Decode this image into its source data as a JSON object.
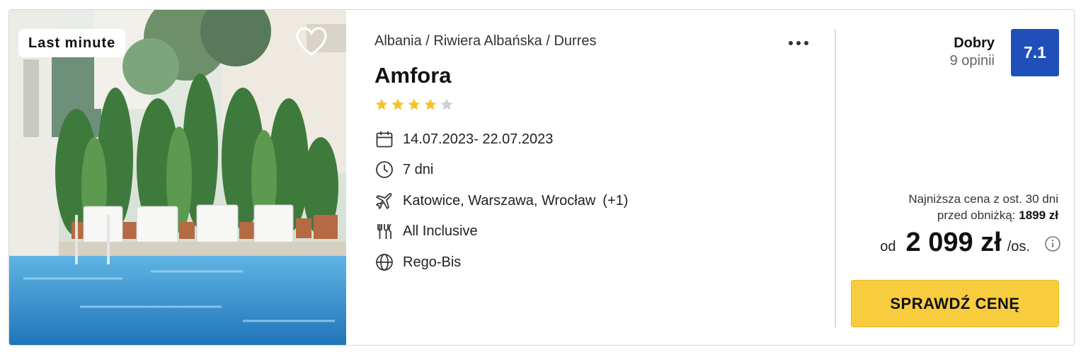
{
  "badge": "Last minute",
  "breadcrumb": "Albania / Riwiera Albańska / Durres",
  "hotel": {
    "name": "Amfora",
    "stars_filled": 4,
    "stars_total": 5,
    "star_color": "#f5c22b",
    "star_empty_color": "#cfcfcf"
  },
  "details": {
    "dates": "14.07.2023- 22.07.2023",
    "duration": "7 dni",
    "departures": "Katowice, Warszawa, Wrocław",
    "departures_extra": "(+1)",
    "board": "All Inclusive",
    "operator": "Rego-Bis"
  },
  "icons": {
    "calendar": "calendar-icon",
    "clock": "clock-icon",
    "plane": "plane-icon",
    "cutlery": "cutlery-icon",
    "globe": "globe-icon",
    "heart": "heart-icon",
    "more": "more-dots-icon",
    "info": "info-icon"
  },
  "rating": {
    "label": "Dobry",
    "count": "9 opinii",
    "score": "7.1",
    "score_color": "#1f4fb8"
  },
  "price": {
    "lowest_line1": "Najniższa cena z ost. 30 dni",
    "lowest_line2_prefix": "przed obniżką:",
    "lowest_value": "1899 zł",
    "prefix": "od",
    "amount": "2 099 zł",
    "per": "/os."
  },
  "cta": {
    "label": "SPRAWDŹ CENĘ",
    "color": "#f7cd3f"
  }
}
